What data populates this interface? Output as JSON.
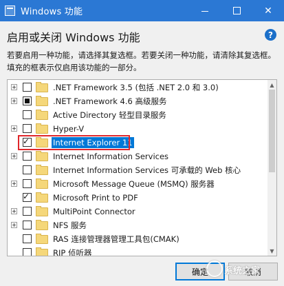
{
  "window": {
    "title": "Windows 功能",
    "close_glyph": "✕"
  },
  "heading": "启用或关闭 Windows 功能",
  "help_glyph": "?",
  "description": "若要启用一种功能，请选择其复选框。若要关闭一种功能，请清除其复选框。填充的框表示仅启用该功能的一部分。",
  "features": [
    {
      "label": ".NET Framework 3.5 (包括 .NET 2.0 和 3.0)",
      "expander": true,
      "state": "unchecked"
    },
    {
      "label": ".NET Framework 4.6 高级服务",
      "expander": true,
      "state": "partial"
    },
    {
      "label": "Active Directory 轻型目录服务",
      "expander": false,
      "state": "unchecked"
    },
    {
      "label": "Hyper-V",
      "expander": true,
      "state": "unchecked"
    },
    {
      "label": "Internet Explorer 11",
      "expander": false,
      "state": "checked",
      "selected": true
    },
    {
      "label": "Internet Information Services",
      "expander": true,
      "state": "unchecked"
    },
    {
      "label": "Internet Information Services 可承载的 Web 核心",
      "expander": false,
      "state": "unchecked"
    },
    {
      "label": "Microsoft Message Queue (MSMQ) 服务器",
      "expander": true,
      "state": "unchecked"
    },
    {
      "label": "Microsoft Print to PDF",
      "expander": false,
      "state": "checked"
    },
    {
      "label": "MultiPoint Connector",
      "expander": true,
      "state": "unchecked"
    },
    {
      "label": "NFS 服务",
      "expander": true,
      "state": "unchecked"
    },
    {
      "label": "RAS 连接管理器管理工具包(CMAK)",
      "expander": false,
      "state": "unchecked"
    },
    {
      "label": "RIP 侦听器",
      "expander": false,
      "state": "unchecked"
    }
  ],
  "check_glyph": "✓",
  "buttons": {
    "ok": "确定",
    "cancel": "取消"
  },
  "watermark": "系统之家",
  "colors": {
    "titlebar": "#2b78d4",
    "selection": "#0078d7",
    "highlight_box": "#e0262a"
  }
}
